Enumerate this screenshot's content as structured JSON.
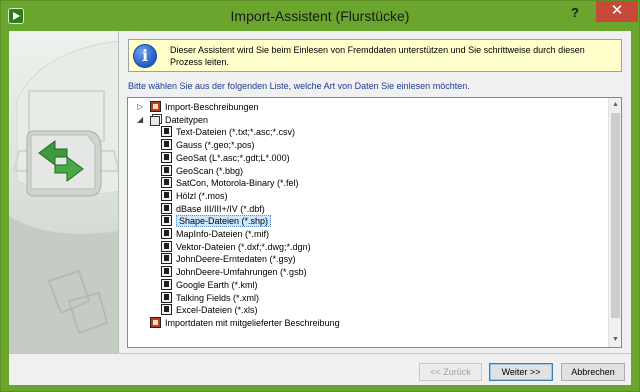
{
  "window": {
    "title": "Import-Assistent (Flurstücke)",
    "help_label": "?",
    "close_label": "✕",
    "accent_color": "#6aa52e"
  },
  "info": {
    "icon": "info-icon",
    "text": "Dieser Assistent wird Sie beim Einlesen von Fremddaten unterstützen und Sie schrittweise durch diesen Prozess leiten."
  },
  "prompt": "Bitte wählen Sie aus der folgenden Liste, welche Art von Daten Sie einlesen möchten.",
  "tree": {
    "items": [
      {
        "label": "Import-Beschreibungen",
        "icon": "import-icon",
        "expander": "▷",
        "level": 0
      },
      {
        "label": "Dateitypen",
        "icon": "stack-icon",
        "expander": "◢",
        "level": 0
      },
      {
        "label": "Text-Dateien (*.txt;*.asc;*.csv)",
        "icon": "document-icon",
        "level": 1
      },
      {
        "label": "Gauss (*.geo;*.pos)",
        "icon": "document-icon",
        "level": 1
      },
      {
        "label": "GeoSat (L*.asc;*.gdt;L*.000)",
        "icon": "document-icon",
        "level": 1
      },
      {
        "label": "GeoScan (*.bbg)",
        "icon": "document-icon",
        "level": 1
      },
      {
        "label": "SatCon, Motorola-Binary (*.fel)",
        "icon": "document-icon",
        "level": 1
      },
      {
        "label": "Hölzl (*.mos)",
        "icon": "document-icon",
        "level": 1
      },
      {
        "label": "dBase III/III+/IV (*.dbf)",
        "icon": "document-icon",
        "level": 1
      },
      {
        "label": "Shape-Dateien (*.shp)",
        "icon": "document-icon",
        "level": 1,
        "selected": true
      },
      {
        "label": "MapInfo-Dateien (*.mif)",
        "icon": "document-icon",
        "level": 1
      },
      {
        "label": "Vektor-Dateien (*.dxf;*.dwg;*.dgn)",
        "icon": "document-icon",
        "level": 1
      },
      {
        "label": "JohnDeere-Erntedaten (*.gsy)",
        "icon": "document-icon",
        "level": 1
      },
      {
        "label": "JohnDeere-Umfahrungen (*.gsb)",
        "icon": "document-icon",
        "level": 1
      },
      {
        "label": "Google Earth (*.kml)",
        "icon": "document-icon",
        "level": 1
      },
      {
        "label": "Talking Fields (*.xml)",
        "icon": "document-icon",
        "level": 1
      },
      {
        "label": "Excel-Dateien (*.xls)",
        "icon": "document-icon",
        "level": 1
      },
      {
        "label": "Importdaten mit mitgelieferter Beschreibung",
        "icon": "import-icon",
        "level": 0
      }
    ]
  },
  "buttons": {
    "back": "<< Zurück",
    "next": "Weiter >>",
    "cancel": "Abbrechen"
  }
}
